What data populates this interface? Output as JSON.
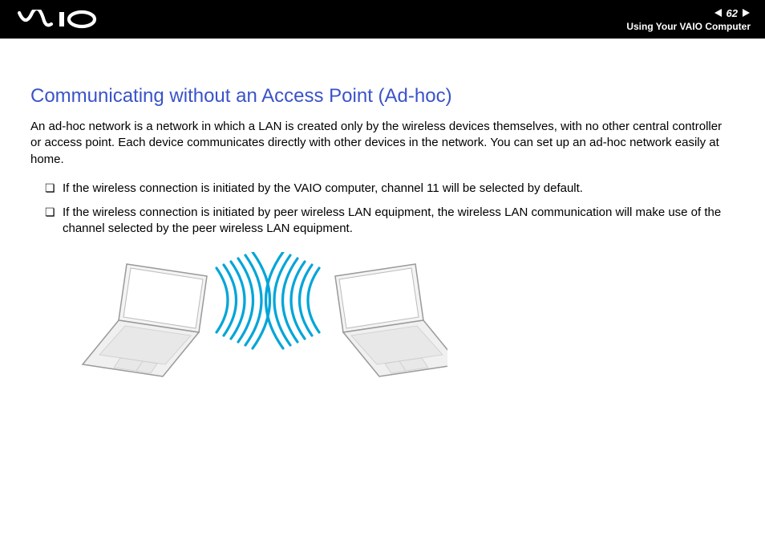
{
  "header": {
    "logo_text": "VAIO",
    "page_number": "62",
    "section": "Using Your VAIO Computer"
  },
  "content": {
    "heading": "Communicating without an Access Point (Ad-hoc)",
    "intro": "An ad-hoc network is a network in which a LAN is created only by the wireless devices themselves, with no other central controller or access point. Each device communicates directly with other devices in the network. You can set up an ad-hoc network easily at home.",
    "bullets": [
      "If the wireless connection is initiated by the VAIO computer, channel 11 will be selected by default.",
      "If the wireless connection is initiated by peer wireless LAN equipment, the wireless LAN communication will make use of the channel selected by the peer wireless LAN equipment."
    ],
    "figure_alt": "Two laptop computers communicating directly via wireless signals"
  }
}
